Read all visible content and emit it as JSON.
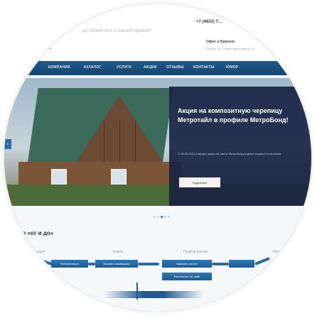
{
  "header": {
    "tagline": "...ду знаем все о вашей кровле!",
    "phone": "+7 (4832) 7...",
    "office": "Офис в Брянске",
    "address": "г. Брянск, ул. Станке Димитрова, д. 67",
    "logo_fragment": "ш"
  },
  "nav": {
    "items": [
      "КОМПАНИЯ",
      "КАТАЛОГ",
      "УСЛУГИ",
      "АКЦИИ",
      "ОТЗЫВЫ",
      "КОНТАКТЫ",
      "ЮМОР"
    ]
  },
  "promo": {
    "title": "Акция на композитную черепицу Метротайл в профиле МетроБонд!",
    "text": "С 18.05.2014 стартует акция на листы Метробонд в цвете терракот и зеленый.",
    "button": "Подробнее"
  },
  "slider": {
    "arrow_left": "‹",
    "dots_count": 5,
    "active_dot": 2
  },
  "section": {
    "title": "...овля «от и до»",
    "steps": [
      {
        "label": "...сультация",
        "button": "Консультация"
      },
      {
        "label": "Замер",
        "button": "Вызвать замерщика"
      },
      {
        "label": "Подбор-расчет",
        "button": "Заказать расчет",
        "button2": "Рассчитать он-лайн"
      },
      {
        "label": "Монта...",
        "button": ""
      }
    ]
  },
  "colors": {
    "nav_bg": "#1f5a8a",
    "accent": "#2a6ca8",
    "promo_bg": "#182442",
    "logo_red": "#e31e24"
  }
}
